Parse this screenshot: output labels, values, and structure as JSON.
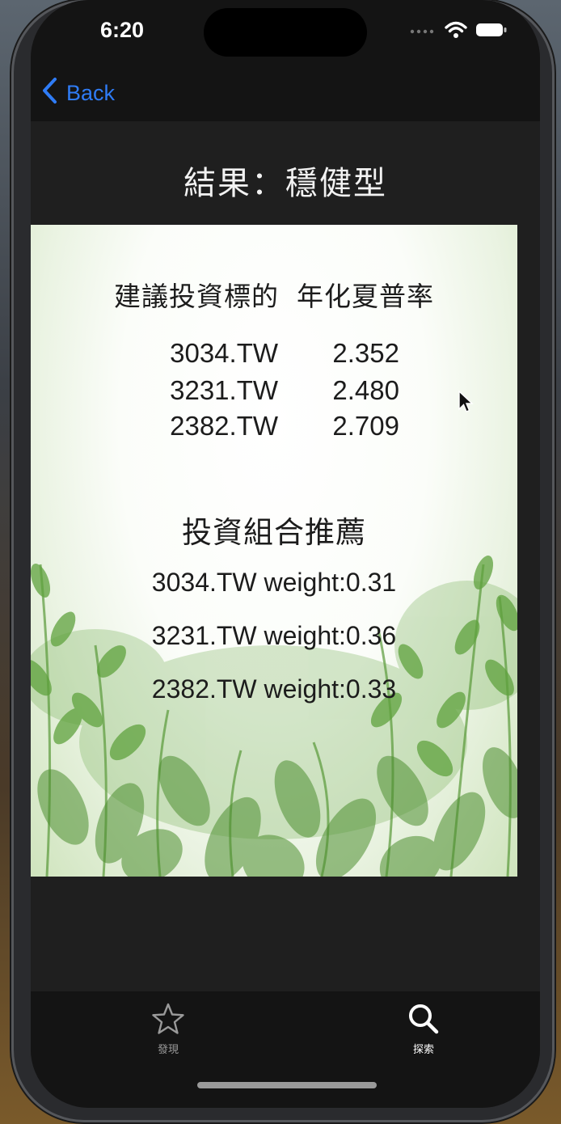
{
  "status": {
    "time": "6:20"
  },
  "nav": {
    "back_label": "Back"
  },
  "title": "結果：穩健型",
  "card": {
    "header": {
      "col1": "建議投資標的",
      "col2": "年化夏普率"
    },
    "sharpe_rows": [
      {
        "symbol": "3034.TW",
        "value": "2.352"
      },
      {
        "symbol": "3231.TW",
        "value": "2.480"
      },
      {
        "symbol": "2382.TW",
        "value": "2.709"
      }
    ],
    "portfolio_title": "投資組合推薦",
    "weights": [
      "3034.TW weight:0.31",
      "3231.TW weight:0.36",
      "2382.TW weight:0.33"
    ]
  },
  "tabbar": {
    "items": [
      {
        "label": "發現",
        "icon": "star-icon"
      },
      {
        "label": "探索",
        "icon": "search-icon"
      }
    ]
  },
  "colors": {
    "accent": "#2f7cf6",
    "background": "#1f1f1f",
    "bars": "#141414"
  }
}
